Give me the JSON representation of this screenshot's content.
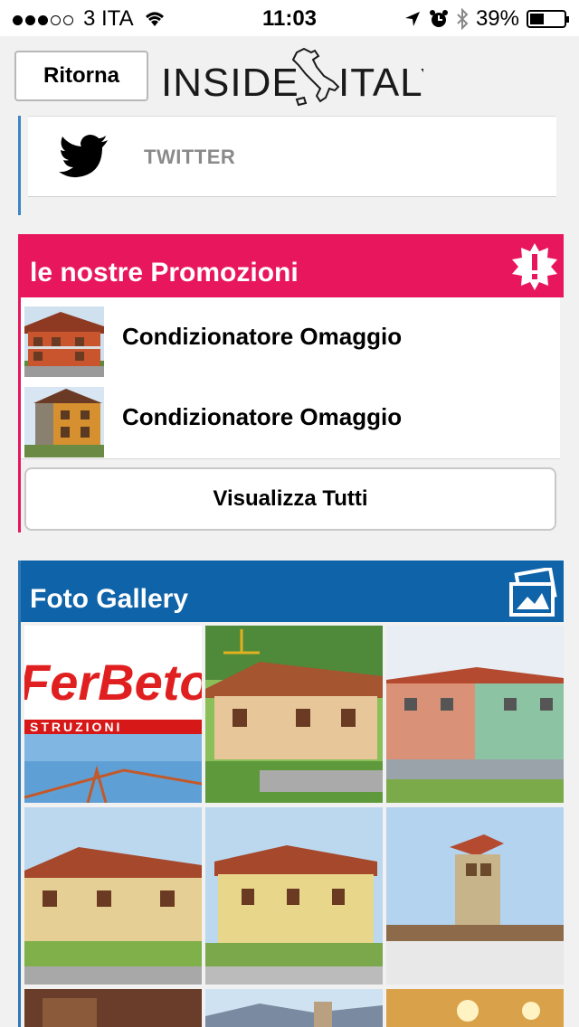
{
  "status_bar": {
    "carrier": "3 ITA",
    "time": "11:03",
    "battery": "39%"
  },
  "header": {
    "back_label": "Ritorna",
    "logo_left": "INSIDE",
    "logo_right": "ITALY"
  },
  "social": {
    "twitter_label": "TWITTER"
  },
  "promotions": {
    "title": "le nostre Promozioni",
    "items": [
      {
        "label": "Condizionatore Omaggio"
      },
      {
        "label": "Condizionatore Omaggio"
      }
    ],
    "view_all_label": "Visualizza Tutti"
  },
  "gallery": {
    "title": "Foto Gallery",
    "ferbeto_text": "FerBeto",
    "ferbeto_sub": "STRUZIONI"
  },
  "colors": {
    "promo_accent": "#e8175d",
    "gallery_accent": "#0f63a9",
    "twitter_accent": "#3d86c6"
  }
}
